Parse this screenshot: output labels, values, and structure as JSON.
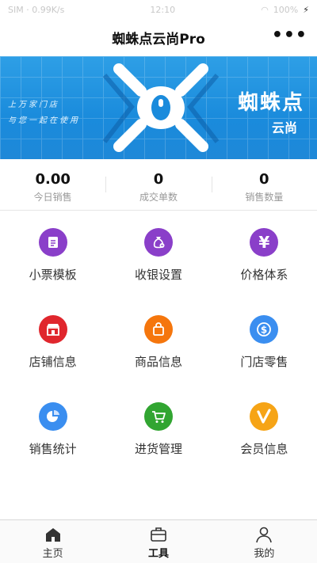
{
  "status_bar": {
    "left": "SIM  ·  0.99K/s",
    "time": "12:10",
    "battery": "100%"
  },
  "nav": {
    "title": "蜘蛛点云尚Pro",
    "more": "•••"
  },
  "banner": {
    "slogan_line1": "上万家门店",
    "slogan_line2": "与您一起在使用",
    "brand_name": "蜘蛛点",
    "brand_sub": "云尚"
  },
  "stats": [
    {
      "value": "0.00",
      "label": "今日销售"
    },
    {
      "value": "0",
      "label": "成交单数"
    },
    {
      "value": "0",
      "label": "销售数量"
    }
  ],
  "menu": [
    {
      "label": "小票模板",
      "icon": "receipt-icon",
      "color": "#8a3fc9"
    },
    {
      "label": "收银设置",
      "icon": "money-bag-icon",
      "color": "#8a3fc9"
    },
    {
      "label": "价格体系",
      "icon": "yen-icon",
      "color": "#8a3fc9"
    },
    {
      "label": "店铺信息",
      "icon": "store-icon",
      "color": "#e0262d"
    },
    {
      "label": "商品信息",
      "icon": "shopping-bag-icon",
      "color": "#f5760d"
    },
    {
      "label": "门店零售",
      "icon": "dollar-coin-icon",
      "color": "#3a8ef0"
    },
    {
      "label": "销售统计",
      "icon": "pie-chart-icon",
      "color": "#3a8ef0"
    },
    {
      "label": "进货管理",
      "icon": "cart-icon",
      "color": "#31a531"
    },
    {
      "label": "会员信息",
      "icon": "vip-v-icon",
      "color": "#f6a416"
    }
  ],
  "tabs": [
    {
      "label": "主页",
      "icon": "home-icon"
    },
    {
      "label": "工具",
      "icon": "toolbox-icon",
      "active": true
    },
    {
      "label": "我的",
      "icon": "person-icon"
    }
  ]
}
